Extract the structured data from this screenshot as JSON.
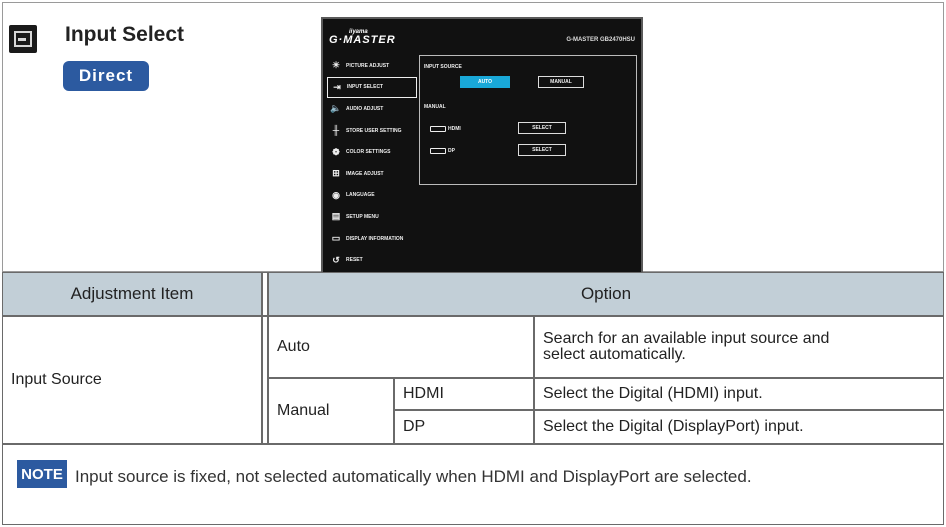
{
  "header": {
    "title": "Input Select",
    "badge": "Direct"
  },
  "osd": {
    "brand_small": "iiyama",
    "brand": "G·MASTER",
    "model": "G-MASTER GB2470HSU",
    "menu": [
      {
        "icon": "picture-adjust-icon",
        "glyph": "☀",
        "label": "PICTURE ADJUST"
      },
      {
        "icon": "input-select-icon",
        "glyph": "⇥",
        "label": "INPUT SELECT",
        "selected": true
      },
      {
        "icon": "audio-adjust-icon",
        "glyph": "🔈",
        "label": "AUDIO ADJUST"
      },
      {
        "icon": "store-user-setting-icon",
        "glyph": "╫",
        "label": "STORE USER SETTING"
      },
      {
        "icon": "color-settings-icon",
        "glyph": "❁",
        "label": "COLOR SETTINGS"
      },
      {
        "icon": "image-adjust-icon",
        "glyph": "⊞",
        "label": "IMAGE ADJUST"
      },
      {
        "icon": "language-icon",
        "glyph": "◉",
        "label": "LANGUAGE"
      },
      {
        "icon": "setup-menu-icon",
        "glyph": "▤",
        "label": "SETUP MENU"
      },
      {
        "icon": "display-information-icon",
        "glyph": "▭",
        "label": "DISPLAY INFORMATION"
      },
      {
        "icon": "reset-icon",
        "glyph": "↺",
        "label": "RESET"
      }
    ],
    "panel": {
      "input_source_label": "INPUT SOURCE",
      "auto_label": "AUTO",
      "manual_label": "MANUAL",
      "manual_section_label": "MANUAL",
      "hdmi_label": "HDMI",
      "dp_label": "DP",
      "select_label": "SELECT"
    },
    "accent_color": "#19a8d8"
  },
  "table": {
    "col_adjustment": "Adjustment Item",
    "col_option": "Option",
    "item": "Input Source",
    "auto": "Auto",
    "auto_desc_1": "Search for an available input source and",
    "auto_desc_2": "select automatically.",
    "manual": "Manual",
    "hdmi": "HDMI",
    "hdmi_desc": "Select the Digital (HDMI) input.",
    "dp": "DP",
    "dp_desc": "Select the Digital (DisplayPort) input.",
    "header_color": "#c2cfd7"
  },
  "note": {
    "badge": "NOTE",
    "text": "Input source is fixed, not selected automatically when HDMI and DisplayPort are selected."
  }
}
